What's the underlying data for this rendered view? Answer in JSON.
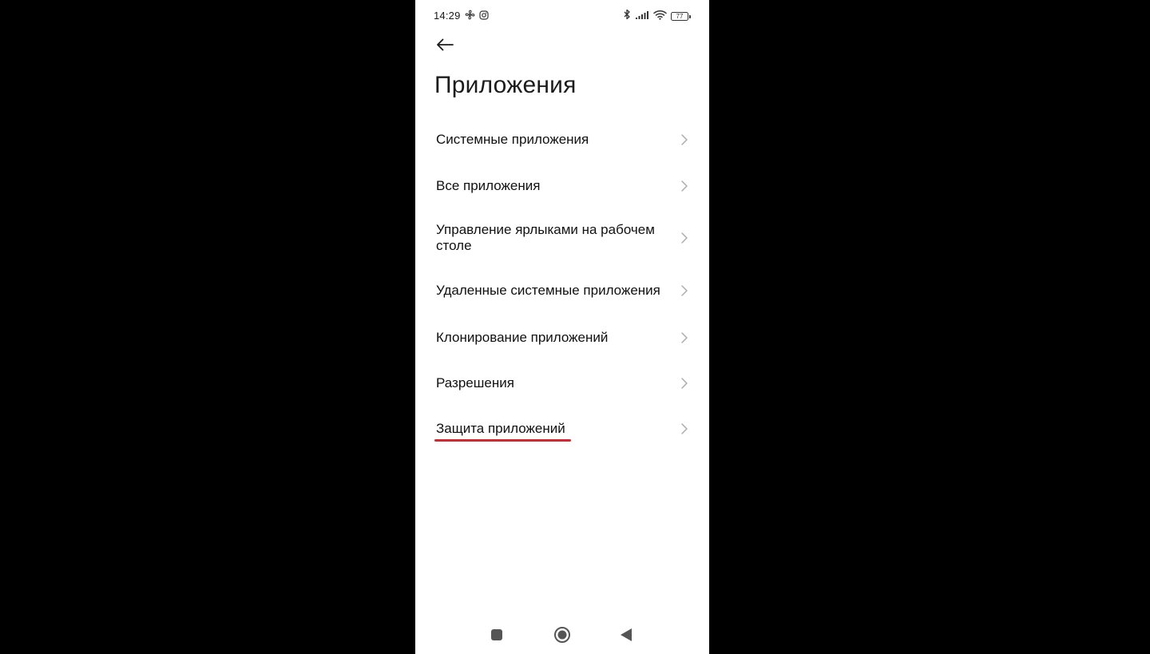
{
  "status_bar": {
    "time": "14:29",
    "battery_level": "77",
    "left_icons": [
      "fan-icon",
      "instagram-icon"
    ],
    "right_icons": [
      "bluetooth-icon",
      "signal-icon",
      "wifi-icon",
      "battery-icon"
    ]
  },
  "header": {
    "back_icon": "arrow-left-icon",
    "title": "Приложения"
  },
  "menu": {
    "items": [
      {
        "label": "Системные приложения"
      },
      {
        "label": "Все приложения"
      },
      {
        "label": "Управление ярлыками на рабочем столе"
      },
      {
        "label": "Удаленные системные приложения"
      },
      {
        "label": "Клонирование приложений"
      },
      {
        "label": "Разрешения"
      },
      {
        "label": "Защита приложений"
      }
    ],
    "highlighted_item": "Защита приложений",
    "highlight_color": "#d4272f"
  },
  "nav_bar": {
    "buttons": [
      "recents-square-icon",
      "home-circle-icon",
      "back-triangle-icon"
    ]
  }
}
